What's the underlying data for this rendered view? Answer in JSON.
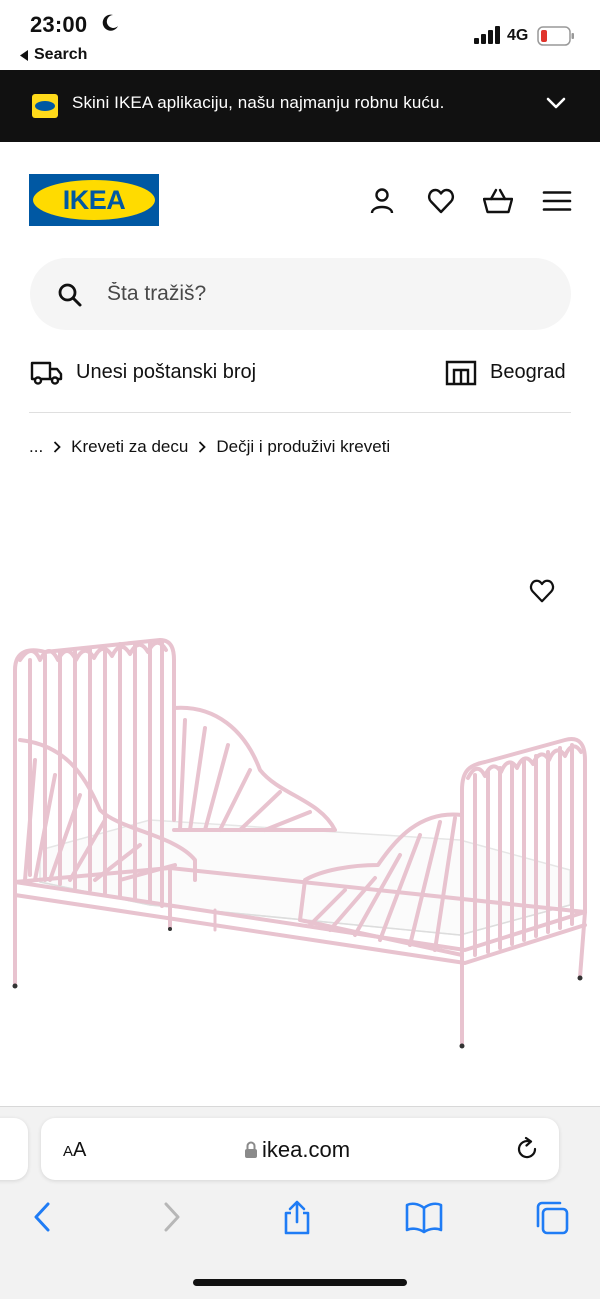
{
  "status_bar": {
    "time": "23:00",
    "back_label": "Search",
    "network": "4G",
    "icons": [
      "moon-icon",
      "signal-icon",
      "battery-icon"
    ]
  },
  "promo": {
    "text": "Skini IKEA aplikaciju, našu najmanju robnu kuću."
  },
  "header": {
    "logo_text": "IKEA",
    "icons": [
      "account-icon",
      "heart-icon",
      "basket-icon",
      "menu-icon"
    ]
  },
  "search": {
    "placeholder": "Šta tražiš?"
  },
  "delivery": {
    "postal_label": "Unesi poštanski broj",
    "store_label": "Beograd"
  },
  "breadcrumb": {
    "ellipsis": "...",
    "items": [
      "Kreveti za decu",
      "Dečji i produživi kreveti"
    ]
  },
  "safari": {
    "aa_small": "A",
    "aa_large": "A",
    "url": "ikea.com",
    "toolbar": [
      "back-icon",
      "forward-icon",
      "share-icon",
      "bookmarks-icon",
      "tabs-icon"
    ]
  },
  "colors": {
    "ikea_blue": "#0058a3",
    "ikea_yellow": "#ffdb00",
    "bed_pink": "#e8c3cf",
    "safari_blue": "#1f7cf5"
  }
}
